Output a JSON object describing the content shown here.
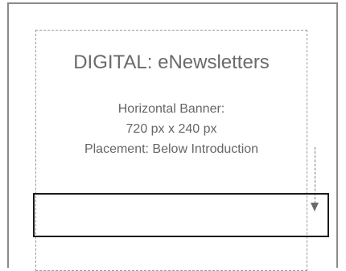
{
  "title": "DIGITAL: eNewsletters",
  "info": {
    "line1": "Horizontal Banner:",
    "line2": "720 px x  240 px",
    "line3": "Placement: Below Introduction"
  },
  "colors": {
    "text": "#666666",
    "frame": "#8a8a8a",
    "banner_outline": "#1a1a1a"
  },
  "icons": {
    "placement_arrow": "arrow-down-icon"
  }
}
